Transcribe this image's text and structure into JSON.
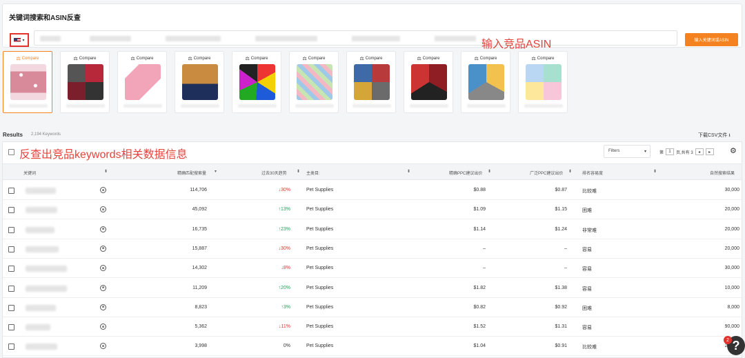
{
  "search_panel": {
    "title": "关键词搜索和ASIN反查",
    "search_button_label": "输入关键词或ASIN",
    "annotation": "输入竞品ASIN",
    "input_placeholder": ""
  },
  "products": [
    {
      "compare_label": "Compare",
      "active": true,
      "image": "pink-floral-bandana"
    },
    {
      "compare_label": "Compare",
      "active": false,
      "image": "multicolor-bandana-set"
    },
    {
      "compare_label": "Compare",
      "active": false,
      "image": "pink-bandana"
    },
    {
      "compare_label": "Compare",
      "active": false,
      "image": "dog-wearing-bandana"
    },
    {
      "compare_label": "Compare",
      "active": false,
      "image": "colorful-bandana-set"
    },
    {
      "compare_label": "Compare",
      "active": false,
      "image": "bandana-grid-set"
    },
    {
      "compare_label": "Compare",
      "active": false,
      "image": "plaid-bandana-set"
    },
    {
      "compare_label": "Compare",
      "active": false,
      "image": "red-black-bandana-set"
    },
    {
      "compare_label": "Compare",
      "active": false,
      "image": "yellow-gray-bandana-set"
    },
    {
      "compare_label": "Compare",
      "active": false,
      "image": "pastel-bandana-set"
    }
  ],
  "results": {
    "label": "Results",
    "count": "2,194 Keywords",
    "download": "下载CSV文件",
    "annotation": "反查出竞品keywords相关数据信息",
    "filters_label": "Filters",
    "pager": {
      "prefix": "第",
      "page": "1",
      "suffix": "页,共有 3"
    }
  },
  "table": {
    "headers": {
      "keyword": "关键词",
      "search_volume": "精确匹配搜索量",
      "trend": "过去30天趋势",
      "category": "主类目:",
      "ppc_exact": "精确PPC建议出价",
      "ppc_broad": "广泛PPC建议出价",
      "competition": "排名容易度",
      "results": "自然搜索结果"
    },
    "rows": [
      {
        "volume": "114,706",
        "trend": "30%",
        "dir": "down",
        "category": "Pet Supplies",
        "ppc_exact": "$0.88",
        "ppc_broad": "$0.87",
        "competition": "比较难",
        "results": "30,000"
      },
      {
        "volume": "45,092",
        "trend": "13%",
        "dir": "up",
        "category": "Pet Supplies",
        "ppc_exact": "$1.09",
        "ppc_broad": "$1.15",
        "competition": "困难",
        "results": "20,000"
      },
      {
        "volume": "16,735",
        "trend": "23%",
        "dir": "up",
        "category": "Pet Supplies",
        "ppc_exact": "$1.14",
        "ppc_broad": "$1.24",
        "competition": "非常难",
        "results": "20,000"
      },
      {
        "volume": "15,887",
        "trend": "30%",
        "dir": "down",
        "category": "Pet Supplies",
        "ppc_exact": "–",
        "ppc_broad": "–",
        "competition": "容易",
        "results": "20,000"
      },
      {
        "volume": "14,302",
        "trend": "8%",
        "dir": "down",
        "category": "Pet Supplies",
        "ppc_exact": "–",
        "ppc_broad": "–",
        "competition": "容易",
        "results": "30,000"
      },
      {
        "volume": "11,209",
        "trend": "20%",
        "dir": "up",
        "category": "Pet Supplies",
        "ppc_exact": "$1.82",
        "ppc_broad": "$1.38",
        "competition": "容易",
        "results": "10,000"
      },
      {
        "volume": "8,823",
        "trend": "3%",
        "dir": "up",
        "category": "Pet Supplies",
        "ppc_exact": "$0.82",
        "ppc_broad": "$0.92",
        "competition": "困难",
        "results": "8,000"
      },
      {
        "volume": "5,362",
        "trend": "11%",
        "dir": "down",
        "category": "Pet Supplies",
        "ppc_exact": "$1.52",
        "ppc_broad": "$1.31",
        "competition": "容易",
        "results": "90,000"
      },
      {
        "volume": "3,998",
        "trend": "0%",
        "dir": "flat",
        "category": "Pet Supplies",
        "ppc_exact": "$1.04",
        "ppc_broad": "$0.91",
        "competition": "比较难",
        "results": "20,000"
      }
    ]
  },
  "help": {
    "badge": "2",
    "icon": "?"
  },
  "colors": {
    "accent": "#f58220",
    "annotation": "#e8423b",
    "up": "#1aa35b",
    "down": "#e3322b"
  }
}
